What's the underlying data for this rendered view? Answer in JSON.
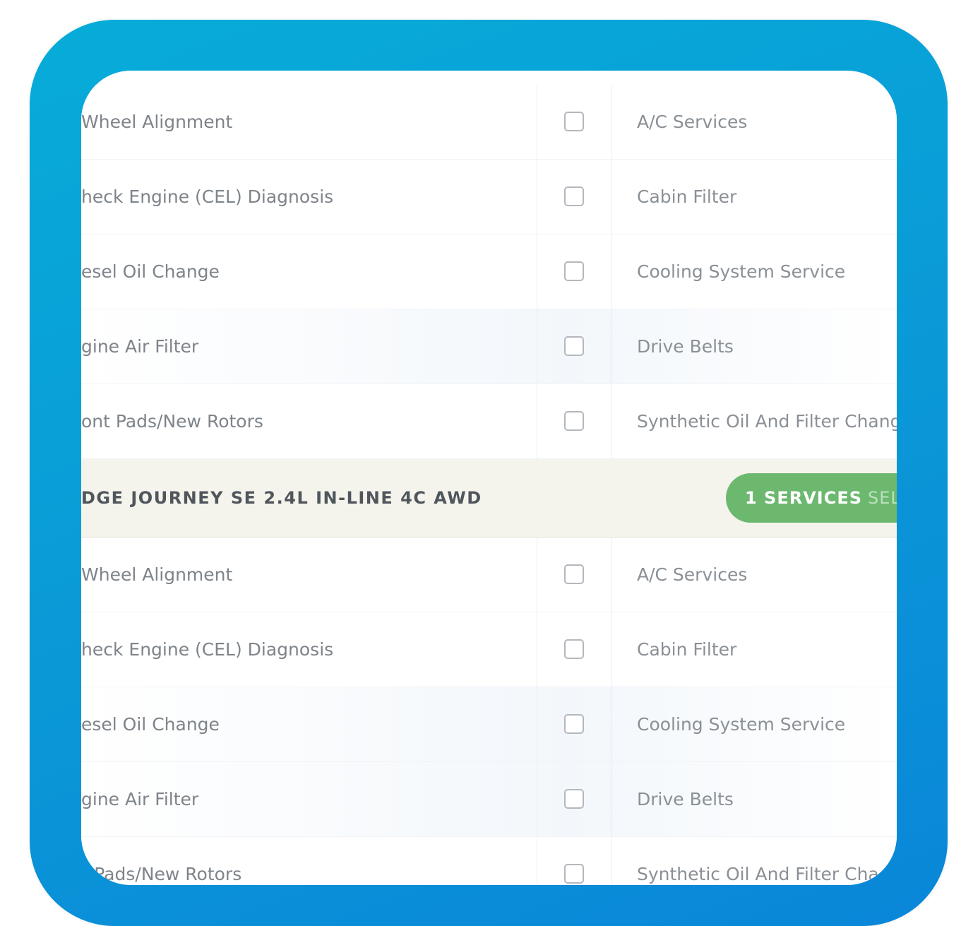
{
  "top_rows": [
    {
      "left": "Wheel Alignment",
      "right": "A/C Services"
    },
    {
      "left": "heck Engine (CEL) Diagnosis",
      "right": "Cabin Filter"
    },
    {
      "left": "esel Oil Change",
      "right": "Cooling System Service"
    },
    {
      "left": "gine Air Filter",
      "right": "Drive Belts"
    },
    {
      "left": "ont Pads/New Rotors",
      "right": "Synthetic Oil And Filter Chang"
    }
  ],
  "vehicle_group": {
    "title": "DGE JOURNEY SE 2.4L IN-LINE 4C AWD",
    "badge_count": "1 SERVICES",
    "badge_rest": "SELE"
  },
  "bottom_rows": [
    {
      "left": "Wheel Alignment",
      "right": "A/C Services"
    },
    {
      "left": "heck Engine (CEL) Diagnosis",
      "right": "Cabin Filter"
    },
    {
      "left": "esel Oil Change",
      "right": "Cooling System Service"
    },
    {
      "left": "gine Air Filter",
      "right": "Drive Belts"
    },
    {
      "left": "r Pads/New Rotors",
      "right": "Synthetic Oil And Filter Cha"
    }
  ],
  "colors": {
    "frame": "#0a9ad7",
    "badge": "#6cb86f",
    "group_bg": "#f5f4ec"
  }
}
